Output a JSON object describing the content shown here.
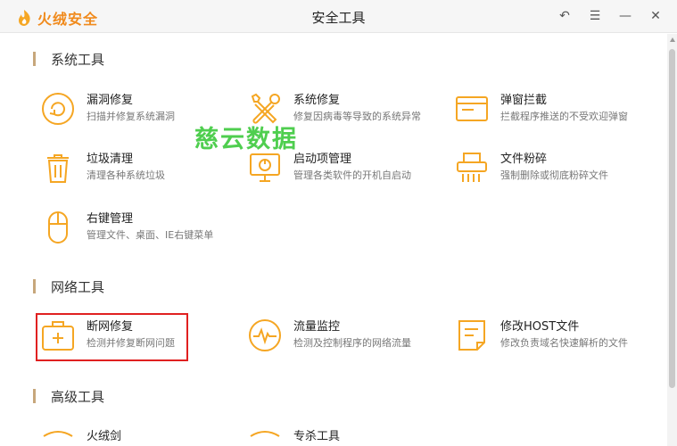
{
  "app": {
    "name": "火绒安全",
    "window_title": "安全工具"
  },
  "window_controls": [
    {
      "name": "back-icon",
      "glyph": "↶"
    },
    {
      "name": "menu-icon",
      "glyph": "☰"
    },
    {
      "name": "minimize-icon",
      "glyph": "—"
    },
    {
      "name": "close-icon",
      "glyph": "✕"
    }
  ],
  "sections": {
    "system": {
      "title": "系统工具",
      "tools": [
        {
          "name": "漏洞修复",
          "desc": "扫描并修复系统漏洞"
        },
        {
          "name": "系统修复",
          "desc": "修复因病毒等导致的系统异常"
        },
        {
          "name": "弹窗拦截",
          "desc": "拦截程序推送的不受欢迎弹窗"
        },
        {
          "name": "垃圾清理",
          "desc": "清理各种系统垃圾"
        },
        {
          "name": "启动项管理",
          "desc": "管理各类软件的开机自启动"
        },
        {
          "name": "文件粉碎",
          "desc": "强制删除或彻底粉碎文件"
        },
        {
          "name": "右键管理",
          "desc": "管理文件、桌面、IE右键菜单"
        }
      ]
    },
    "network": {
      "title": "网络工具",
      "tools": [
        {
          "name": "断网修复",
          "desc": "检测并修复断网问题"
        },
        {
          "name": "流量监控",
          "desc": "检测及控制程序的网络流量"
        },
        {
          "name": "修改HOST文件",
          "desc": "修改负责域名快速解析的文件"
        }
      ]
    },
    "advanced": {
      "title": "高级工具",
      "tools": [
        {
          "name": "火绒剑",
          "desc": ""
        },
        {
          "name": "专杀工具",
          "desc": ""
        }
      ]
    }
  },
  "watermark": "慈云数据",
  "colors": {
    "accent": "#f5a623",
    "highlight": "#e02020",
    "section_bar": "#c7a77b",
    "watermark": "#3dc93d"
  }
}
